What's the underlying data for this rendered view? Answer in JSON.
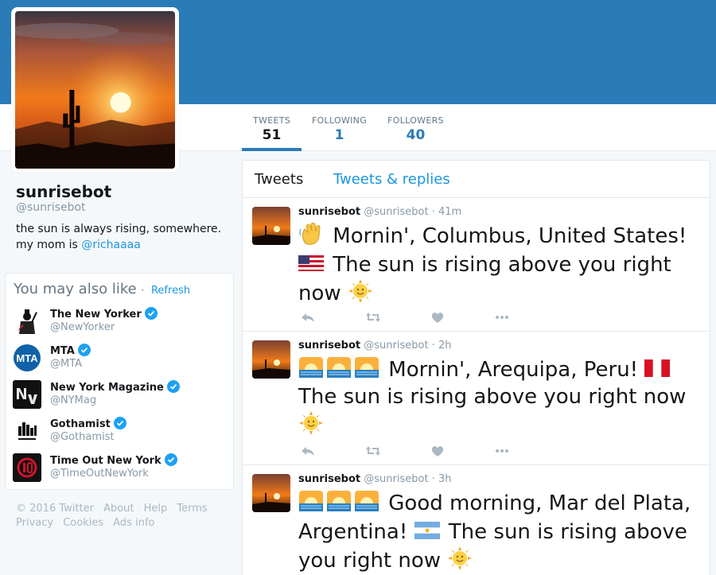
{
  "profile": {
    "name": "sunrisebot",
    "handle": "@sunrisebot",
    "bio_text": "the sun is always rising, somewhere. my mom is ",
    "bio_link": "@richaaaa"
  },
  "stats": [
    {
      "label": "TWEETS",
      "value": "51"
    },
    {
      "label": "FOLLOWING",
      "value": "1"
    },
    {
      "label": "FOLLOWERS",
      "value": "40"
    }
  ],
  "tabs": {
    "tweets": "Tweets",
    "replies": "Tweets & replies"
  },
  "suggestions": {
    "title": "You may also like",
    "separator": "·",
    "refresh": "Refresh",
    "items": [
      {
        "name": "The New Yorker",
        "handle": "@NewYorker"
      },
      {
        "name": "MTA",
        "handle": "@MTA"
      },
      {
        "name": "New York Magazine",
        "handle": "@NYMag"
      },
      {
        "name": "Gothamist",
        "handle": "@Gothamist"
      },
      {
        "name": "Time Out New York",
        "handle": "@TimeOutNewYork"
      }
    ]
  },
  "footer": {
    "copyright": "© 2016 Twitter",
    "about": "About",
    "help": "Help",
    "terms": "Terms",
    "privacy": "Privacy",
    "cookies": "Cookies",
    "ads": "Ads info"
  },
  "tweets": [
    {
      "name": "sunrisebot",
      "handle": "@sunrisebot",
      "time": "41m",
      "text_a": "Mornin', Columbus, United States!",
      "text_b": "The sun is rising above you right now",
      "icons": [
        "waving-hand-icon",
        "us-flag-icon",
        "sun-face-icon"
      ]
    },
    {
      "name": "sunrisebot",
      "handle": "@sunrisebot",
      "time": "2h",
      "text_a": "Mornin', Arequipa, Peru!",
      "text_b": "The sun is rising above you right now",
      "icons": [
        "sunrise-icon",
        "peru-flag-icon",
        "sun-face-icon"
      ]
    },
    {
      "name": "sunrisebot",
      "handle": "@sunrisebot",
      "time": "3h",
      "text_a": "Good morning, Mar del Plata, Argentina!",
      "text_b": "The sun is rising above you right now",
      "icons": [
        "sunrise-icon",
        "argentina-flag-icon",
        "sun-face-icon"
      ]
    }
  ],
  "colors": {
    "banner": "#2b7bb9",
    "link": "#1b95e0",
    "muted": "#8899a6"
  }
}
